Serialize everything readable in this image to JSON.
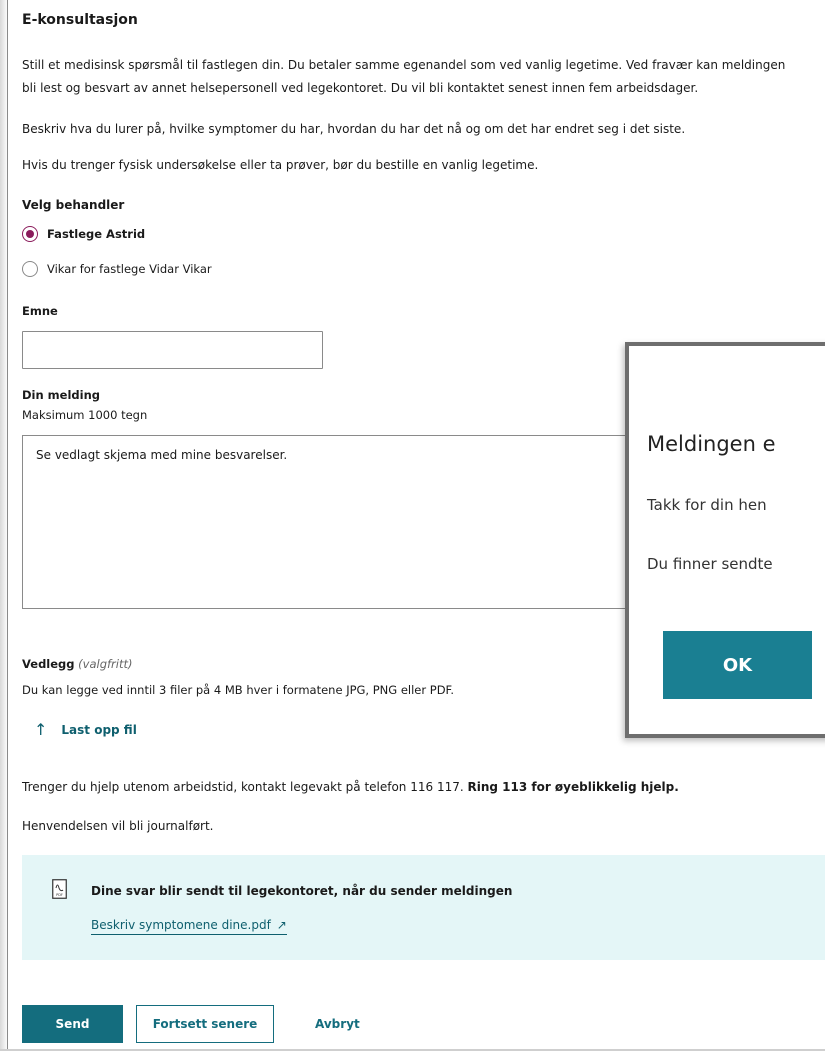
{
  "page": {
    "title": "E-konsultasjon",
    "intro_line1": "Still et medisinsk spørsmål til fastlegen din. Du betaler samme egenandel som ved vanlig legetime. Ved fravær kan meldingen",
    "intro_line2": "bli lest og besvart av annet helsepersonell ved legekontoret. Du vil bli kontaktet senest innen fem arbeidsdager.",
    "describe_text": "Beskriv hva du lurer på, hvilke symptomer du har, hvordan du har det nå og om det har endret seg i det siste.",
    "exam_text": "Hvis du trenger fysisk undersøkelse eller ta prøver, bør du bestille en vanlig legetime."
  },
  "practitioner": {
    "label": "Velg behandler",
    "options": [
      {
        "label": "Fastlege Astrid",
        "selected": true
      },
      {
        "label": "Vikar for fastlege Vidar Vikar",
        "selected": false
      }
    ]
  },
  "subject": {
    "label": "Emne",
    "value": ""
  },
  "message": {
    "label": "Din melding",
    "hint": "Maksimum 1000 tegn",
    "value": "Se vedlagt skjema med mine besvarelser."
  },
  "attachments": {
    "label": "Vedlegg",
    "optional": "(valgfritt)",
    "hint": "Du kan legge ved inntil 3 filer på 4 MB hver i formatene JPG, PNG eller PDF.",
    "upload_label": "Last opp fil",
    "upload_icon": "upload-arrow-icon"
  },
  "notices": {
    "emergency_prefix": "Trenger du hjelp utenom arbeidstid, kontakt legevakt på telefon 116 117. ",
    "emergency_bold": "Ring 113 for øyeblikkelig hjelp.",
    "journal": "Henvendelsen vil bli journalført."
  },
  "info_box": {
    "title": "Dine svar blir sendt til legekontoret, når du sender meldingen",
    "link_text": "Beskriv symptomene dine.pdf",
    "icon": "pdf-file-icon",
    "link_icon": "external-link-icon"
  },
  "actions": {
    "send": "Send",
    "continue_later": "Fortsett senere",
    "cancel": "Avbryt"
  },
  "modal": {
    "title": "Meldingen e",
    "text1": "Takk for din hen",
    "text2": "Du finner sendte",
    "ok": "OK"
  },
  "colors": {
    "accent": "#146d7e",
    "radio": "#8b1c5c",
    "info_bg": "#e4f6f7"
  }
}
